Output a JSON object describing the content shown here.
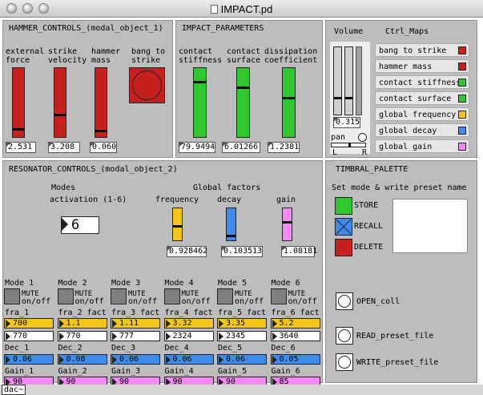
{
  "window": {
    "title": "IMPACT.pd"
  },
  "hammer": {
    "title": "HAMMER_CONTROLS_(modal_object_1)",
    "labels": {
      "force_a": "external",
      "force_b": "force",
      "vel_a": "strike",
      "vel_b": "velocity",
      "mass_a": "hammer",
      "mass_b": "mass",
      "bang_a": "bang to",
      "bang_b": "strike"
    },
    "values": {
      "force": "2.531",
      "velocity": "3.208",
      "mass": "0.060"
    },
    "levels": {
      "force": 0.07,
      "velocity": 0.3,
      "mass": 0.05
    }
  },
  "impact": {
    "title": "IMPACT_PARAMETERS",
    "labels": {
      "stiff_a": "contact",
      "stiff_b": "stiffness",
      "surf_a": "contact",
      "surf_b": "surface",
      "diss_a": "dissipation",
      "diss_b": "coefficient"
    },
    "values": {
      "stiffness": "79.9494",
      "surface": "6.01266",
      "dissipation": "1.2381"
    },
    "levels": {
      "stiffness": 0.8,
      "surface": 0.72,
      "dissipation": 0.55
    }
  },
  "volume": {
    "title": "Volume",
    "value": "0.315",
    "pan_label": "pan",
    "left": "L",
    "right": "R"
  },
  "ctrl_maps": {
    "title": "Ctrl_Maps",
    "items": [
      {
        "label": "bang to strike",
        "color": "#c8201f"
      },
      {
        "label": "hammer mass",
        "color": "#c8201f"
      },
      {
        "label": "contact stiffness",
        "color": "#2ec82e"
      },
      {
        "label": "contact surface",
        "color": "#2ec82e"
      },
      {
        "label": "global frequency",
        "color": "#f5c518"
      },
      {
        "label": "global decay",
        "color": "#3f8cf0"
      },
      {
        "label": "global gain",
        "color": "#f58af5"
      }
    ]
  },
  "resonator": {
    "title": "RESONATOR_CONTROLS_(modal_object_2)",
    "modes_label": "Modes",
    "activation_label": "activation (1-6)",
    "activation_value": "6",
    "global_label": "Global factors",
    "freq_label": "frequency",
    "decay_label": "decay",
    "gain_label": "gain",
    "freq_value": "0.928462",
    "decay_value": "0.103513",
    "gain_value": "1.08181",
    "levels": {
      "freq": 0.4,
      "decay": 0.05,
      "gain": 0.55
    }
  },
  "modes": [
    {
      "name": "Mode 1",
      "mute": "MUTE",
      "onoff": "on/off",
      "fra_label": "fra_1",
      "fra": "700",
      "fra2": "770",
      "dec_label": "Dec_1",
      "dec": "0.06",
      "gain_label": "Gain_1",
      "gain": "90"
    },
    {
      "name": "Mode 2",
      "mute": "MUTE",
      "onoff": "on/off",
      "fra_label": "fra_2 fact",
      "fra": "1.1",
      "fra2": "770",
      "dec_label": "Dec_2",
      "dec": "0.08",
      "gain_label": "Gain_2",
      "gain": "90"
    },
    {
      "name": "Mode 3",
      "mute": "MUTE",
      "onoff": "on/off",
      "fra_label": "fra_3 fact",
      "fra": "1.11",
      "fra2": "777",
      "dec_label": "Dec_3",
      "dec": "0.06",
      "gain_label": "Gain_3",
      "gain": "90"
    },
    {
      "name": "Mode 4",
      "mute": "MUTE",
      "onoff": "on/off",
      "fra_label": "fra_4 fact",
      "fra": "3.32",
      "fra2": "2324",
      "dec_label": "Dec_4",
      "dec": "0.06",
      "gain_label": "Gain_4",
      "gain": "90"
    },
    {
      "name": "Mode 5",
      "mute": "MUTE",
      "onoff": "on/off",
      "fra_label": "fra_5 fact",
      "fra": "3.35",
      "fra2": "2345",
      "dec_label": "Dec_5",
      "dec": "0.06",
      "gain_label": "Gain_5",
      "gain": "90"
    },
    {
      "name": "Mode 6",
      "mute": "MUTE",
      "onoff": "on/off",
      "fra_label": "fra_6 fact",
      "fra": "5.2",
      "fra2": "3640",
      "dec_label": "Dec_6",
      "dec": "0.05",
      "gain_label": "Gain_6",
      "gain": "85"
    }
  ],
  "timbral": {
    "title": "TIMBRAL_PALETTE",
    "subtitle": "Set mode & write preset name",
    "store": "STORE",
    "recall": "RECALL",
    "delete": "DELETE",
    "open": "OPEN_coll",
    "read": "READ_preset_file",
    "write": "WRITE_preset_file"
  },
  "status": {
    "dac": "dac~"
  },
  "colors": {
    "red": "#c8201f",
    "green": "#2ec82e",
    "yellow": "#f5c518",
    "blue": "#3f8cf0",
    "pink": "#f58af5",
    "grey": "#808080"
  }
}
